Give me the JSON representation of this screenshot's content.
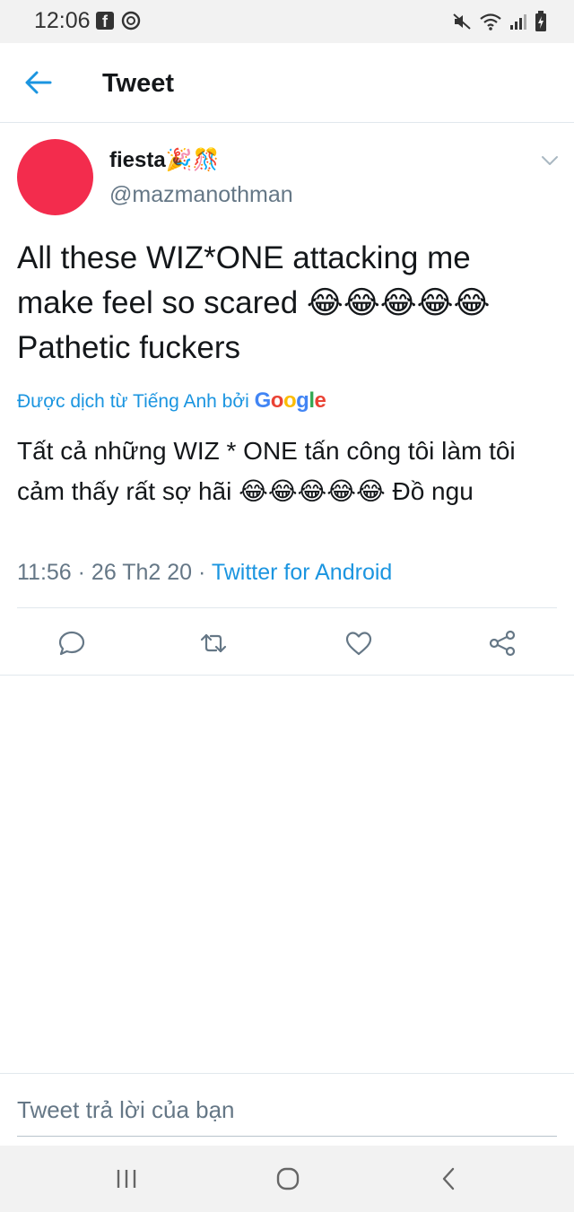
{
  "status_bar": {
    "time": "12:06",
    "app_icons": [
      "facebook-icon",
      "sync-icon"
    ],
    "system_icons": [
      "mute-icon",
      "wifi-icon",
      "signal-icon",
      "battery-charging-icon"
    ]
  },
  "header": {
    "title": "Tweet"
  },
  "tweet": {
    "display_name": "fiesta🎉🎊",
    "handle": "@mazmanothman",
    "text": "All these WIZ*ONE attacking me make feel so scared 😂😂😂😂😂 Pathetic fuckers",
    "translated_by_label": "Được dịch từ Tiếng Anh bởi",
    "translator": "Google",
    "translation": "Tất cả những WIZ * ONE tấn công tôi làm tôi cảm thấy rất sợ hãi 😂😂😂😂😂 Đồ ngu",
    "timestamp": "11:56 · 26 Th2 20 · ",
    "source": "Twitter for Android",
    "avatar_color": "#f32c4d"
  },
  "actions": [
    "reply-icon",
    "retweet-icon",
    "like-icon",
    "share-icon"
  ],
  "reply": {
    "placeholder": "Tweet trả lời của bạn"
  },
  "colors": {
    "accent": "#1b95e0",
    "secondary_text": "#657786",
    "primary_text": "#14171a"
  }
}
